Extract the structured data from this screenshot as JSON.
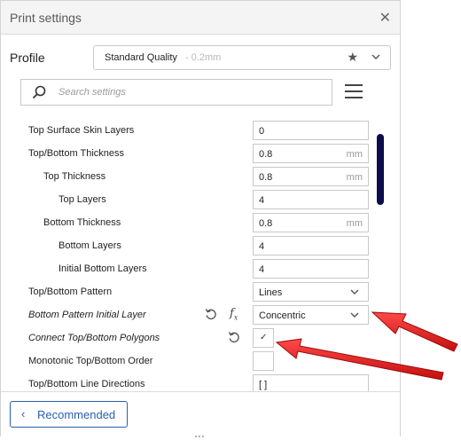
{
  "window": {
    "title": "Print settings"
  },
  "profile": {
    "label": "Profile",
    "name": "Standard Quality",
    "detail": " - 0.2mm"
  },
  "search": {
    "placeholder": "Search settings"
  },
  "settings": [
    {
      "label": "Top Surface Skin Layers",
      "value": "0",
      "unit": ""
    },
    {
      "label": "Top/Bottom Thickness",
      "value": "0.8",
      "unit": "mm"
    },
    {
      "label": "Top Thickness",
      "value": "0.8",
      "unit": "mm"
    },
    {
      "label": "Top Layers",
      "value": "4",
      "unit": ""
    },
    {
      "label": "Bottom Thickness",
      "value": "0.8",
      "unit": "mm"
    },
    {
      "label": "Bottom Layers",
      "value": "4",
      "unit": ""
    },
    {
      "label": "Initial Bottom Layers",
      "value": "4",
      "unit": ""
    },
    {
      "label": "Top/Bottom Pattern",
      "value": "Lines",
      "unit": ""
    },
    {
      "label": "Bottom Pattern Initial Layer",
      "value": "Concentric",
      "unit": ""
    },
    {
      "label": "Connect Top/Bottom Polygons",
      "value": "✓",
      "unit": ""
    },
    {
      "label": "Monotonic Top/Bottom Order",
      "value": "",
      "unit": ""
    },
    {
      "label": "Top/Bottom Line Directions",
      "value": "[ ]",
      "unit": ""
    }
  ],
  "footer": {
    "recommended_label": "Recommended"
  },
  "icons": {
    "search": "search-icon",
    "menu": "hamburger-menu-icon",
    "favorite": "star-icon",
    "reset": "reset-icon",
    "formula": "function-icon",
    "close": "close-icon"
  },
  "colors": {
    "accent": "#2a5fb0",
    "scrollbar": "#0a0f4a",
    "annotation_arrow": "#e01b1b"
  }
}
